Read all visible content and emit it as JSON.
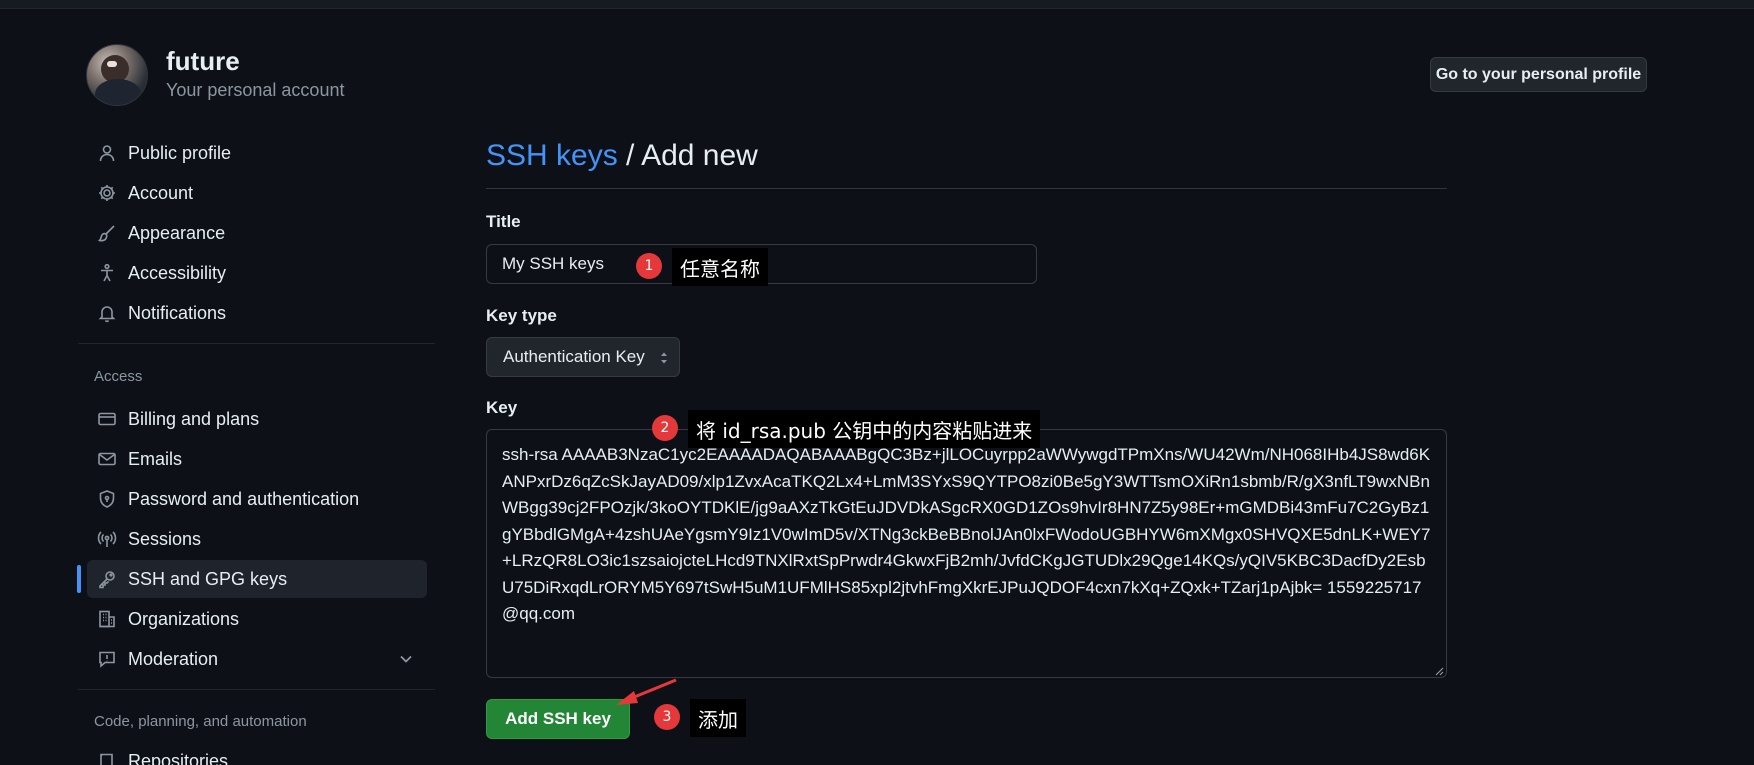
{
  "user": {
    "name": "future",
    "subtitle": "Your personal account"
  },
  "header": {
    "profile_button": "Go to your personal profile"
  },
  "sidebar": {
    "items": [
      {
        "label": "Public profile",
        "icon": "person-icon"
      },
      {
        "label": "Account",
        "icon": "gear-icon"
      },
      {
        "label": "Appearance",
        "icon": "paintbrush-icon"
      },
      {
        "label": "Accessibility",
        "icon": "accessibility-icon"
      },
      {
        "label": "Notifications",
        "icon": "bell-icon"
      }
    ],
    "access_heading": "Access",
    "access_items": [
      {
        "label": "Billing and plans",
        "icon": "credit-card-icon"
      },
      {
        "label": "Emails",
        "icon": "mail-icon"
      },
      {
        "label": "Password and authentication",
        "icon": "shield-lock-icon"
      },
      {
        "label": "Sessions",
        "icon": "broadcast-icon"
      },
      {
        "label": "SSH and GPG keys",
        "icon": "key-icon",
        "active": true
      },
      {
        "label": "Organizations",
        "icon": "organization-icon"
      },
      {
        "label": "Moderation",
        "icon": "report-icon"
      }
    ],
    "code_heading": "Code, planning, and automation",
    "code_items": [
      {
        "label": "Repositories",
        "icon": "repo-icon"
      }
    ]
  },
  "main": {
    "breadcrumb_link": "SSH keys",
    "breadcrumb_sep": " / ",
    "breadcrumb_current": "Add new",
    "title_label": "Title",
    "title_value": "My SSH keys",
    "keytype_label": "Key type",
    "keytype_value": "Authentication Key",
    "key_label": "Key",
    "key_value": "ssh-rsa AAAAB3NzaC1yc2EAAAADAQABAAABgQC3Bz+jlLOCuyrpp2aWWywgdTPmXns/WU42Wm/NH068IHb4JS8wd6KANPxrDz6qZcSkJayAD09/xlp1ZvxAcaTKQ2Lx4+LmM3SYxS9QYTPO8zi0Be5gY3WTTsmOXiRn1sbmb/R/gX3nfLT9wxNBnWBgg39cj2FPOzjk/3koOYTDKlE/jg9aAXzTkGtEuJDVDkASgcRX0GD1ZOs9hvIr8HN7Z5y98Er+mGMDBi43mFu7C2GyBz1gYBbdlGMgA+4zshUAeYgsmY9Iz1V0wImD5v/XTNg3ckBeBBnolJAn0lxFWodoUGBHYW6mXMgx0SHVQXE5dnLK+WEY7+LRzQR8LO3ic1szsaiojcteLHcd9TNXlRxtSpPrwdr4GkwxFjB2mh/JvfdCKgJGTUDlx29Qge14KQs/yQIV5KBC3DacfDy2EsbU75DiRxqdLrORYM5Y697tSwH5uM1UFMlHS85xpl2jtvhFmgXkrEJPuJQDOF4cxn7kXq+ZQxk+TZarj1pAjbk= 1559225717@qq.com",
    "submit_label": "Add SSH key"
  },
  "annotations": [
    {
      "number": "1",
      "text": "任意名称"
    },
    {
      "number": "2",
      "text": "将 id_rsa.pub 公钥中的内容粘贴进来"
    },
    {
      "number": "3",
      "text": "添加"
    }
  ],
  "colors": {
    "accent": "#4493f8",
    "button_green": "#238636",
    "annotation_red": "#e5383b"
  }
}
